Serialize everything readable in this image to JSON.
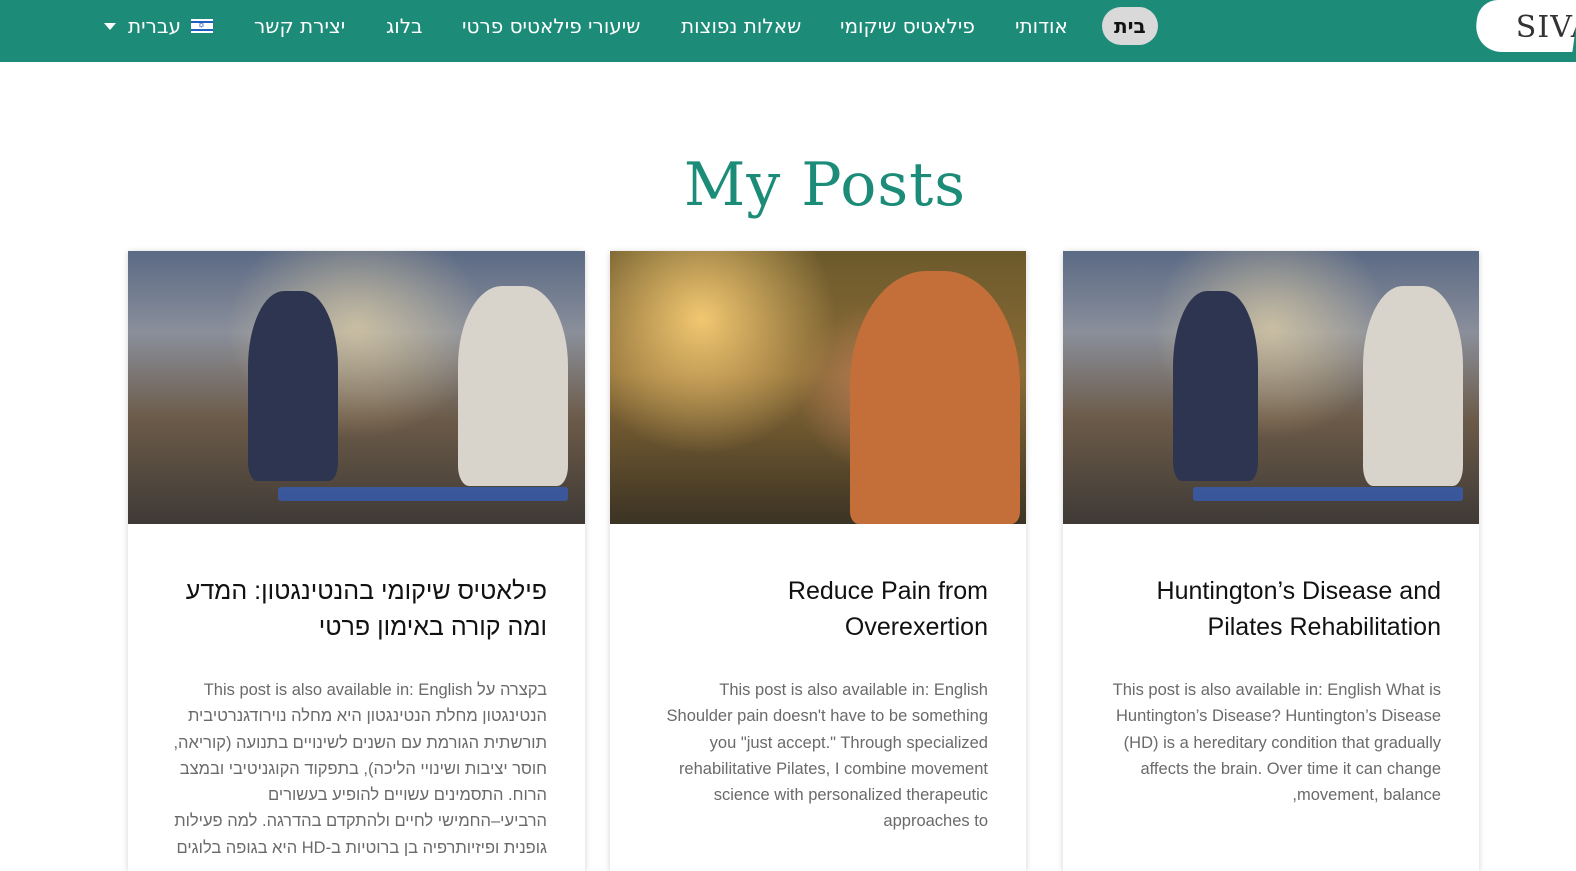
{
  "header": {
    "brand_text": "SIVA",
    "nav": {
      "home": "בית",
      "about": "אודותי",
      "rehab_pilates": "פילאטיס שיקומי",
      "faq": "שאלות נפוצות",
      "private_lessons": "שיעורי פילאטיס פרטי",
      "blog": "בלוג",
      "contact": "יצירת קשר"
    },
    "language": "עברית",
    "flag_icon": "israel-flag-icon",
    "caret_icon": "chevron-down-icon"
  },
  "main": {
    "title": "My Posts",
    "posts": [
      {
        "title_line1": "Huntington’s Disease and",
        "title_line2": "Pilates Rehabilitation",
        "excerpt": [
          "This post is also available in: English What is",
          "Huntington’s Disease? Huntington’s Disease",
          "(HD) is a hereditary condition that gradually",
          "affects the brain. Over time it can change",
          ",movement, balance"
        ]
      },
      {
        "title_line1": "Reduce Pain from",
        "title_line2": "Overexertion",
        "excerpt": [
          "This post is also available in: English",
          "Shoulder pain doesn't have to be something",
          "you \"just accept.\" Through specialized",
          "rehabilitative Pilates, I combine movement",
          "science with personalized therapeutic",
          "approaches to"
        ]
      },
      {
        "title_line1": "פילאטיס שיקומי בהנטינגטון: המדע",
        "title_line2": "ומה קורה באימון פרטי",
        "excerpt": [
          "בקצרה על This post is also available in: English",
          "הנטינגטון מחלת הנטינגטון היא מחלה נוירודגנרטיבית",
          "תורשתית הגורמת עם השנים לשינויים בתנועה (קוריאה,",
          "חוסר יציבות ושינויי הליכה), בתפקוד הקוגניטיבי ובמצב",
          "הרוח. התסמינים עשויים להופיע בעשורים",
          "הרביעי–החמישי לחיים ולהתקדם בהדרגה.   למה פעילות",
          "גופנית ופיזיותרפיה בן ברוטיות ב-HD היא בגופה בלוגים"
        ]
      }
    ]
  },
  "colors": {
    "header_bg": "#1c8c79",
    "title_color": "#1c8c79"
  }
}
